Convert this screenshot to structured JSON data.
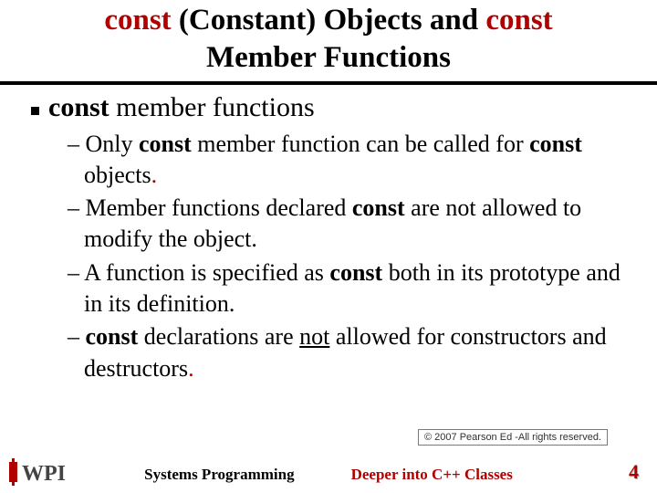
{
  "title": {
    "kw1": "const",
    "mid1": " (Constant) Objects and ",
    "kw2": "const",
    "line2": "Member Functions"
  },
  "main_bullet": {
    "kw": "const",
    "rest": " member functions"
  },
  "subs": {
    "s1a": "– Only ",
    "s1kw1": "const",
    "s1b": " member function can be called for ",
    "s1kw2": "const",
    "s1c": " objects",
    "s1dot": ".",
    "s2a": "– Member functions declared ",
    "s2kw": "const",
    "s2b": " are not allowed to modify the object.",
    "s3a": "– A function is specified as ",
    "s3kw": "const",
    "s3b": " both in its prototype and in its definition.",
    "s4a": "– ",
    "s4kw": "const",
    "s4b": " declarations are ",
    "s4not": "not",
    "s4c": " allowed for constructors and destructors",
    "s4dot": "."
  },
  "copyright": "© 2007 Pearson Ed -All rights reserved.",
  "footer": {
    "center": "Systems Programming",
    "topic": "Deeper into C++ Classes"
  },
  "page_number": "4"
}
